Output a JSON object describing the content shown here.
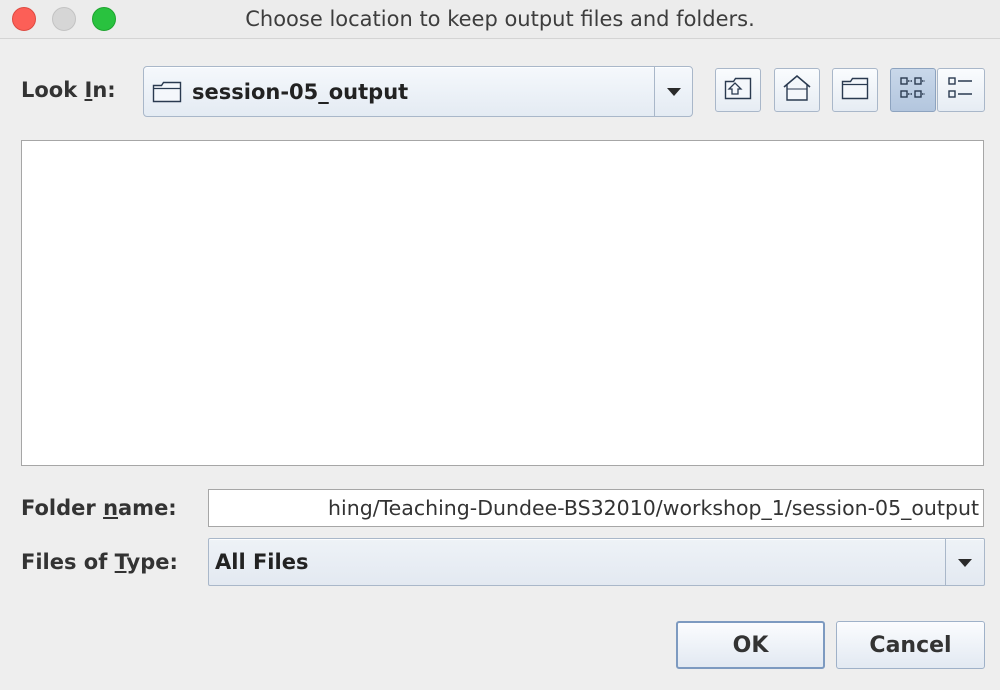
{
  "window": {
    "title": "Choose location to keep output files and folders."
  },
  "look_in": {
    "label_pre": "Look ",
    "label_mnemonic": "I",
    "label_post": "n:",
    "selected": "session-05_output"
  },
  "toolbar": {
    "buttons": [
      {
        "name": "up-one-level",
        "icon": "folder-up-icon"
      },
      {
        "name": "home",
        "icon": "home-icon"
      },
      {
        "name": "new-folder",
        "icon": "new-folder-icon"
      },
      {
        "name": "list-view",
        "icon": "list-view-icon",
        "pressed": true
      },
      {
        "name": "details-view",
        "icon": "details-view-icon",
        "pressed": false
      }
    ]
  },
  "folder_name": {
    "label_pre": "Folder ",
    "label_mnemonic": "n",
    "label_post": "ame:",
    "value": "hing/Teaching-Dundee-BS32010/workshop_1/session-05_output"
  },
  "files_of_type": {
    "label_pre": "Files of ",
    "label_mnemonic": "T",
    "label_post": "ype:",
    "selected": "All Files"
  },
  "actions": {
    "ok_label": "OK",
    "cancel_label": "Cancel"
  },
  "colors": {
    "close": "#fc5f57",
    "minimize": "#d6d6d6",
    "zoom": "#29c23f",
    "button_border": "#a9b7c9"
  }
}
